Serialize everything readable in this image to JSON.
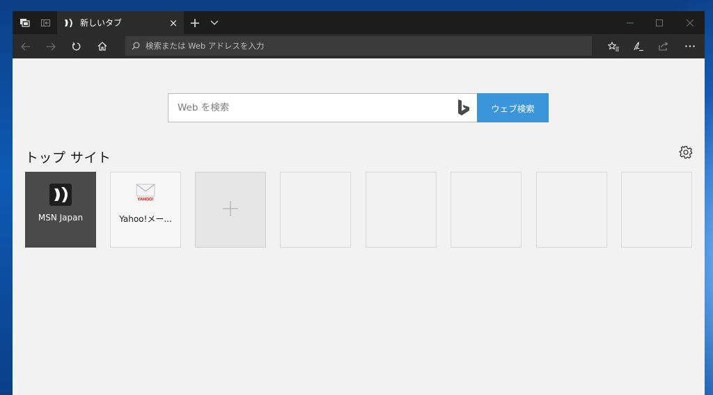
{
  "titlebar": {
    "tab": {
      "title": "新しいタブ"
    },
    "new_tab_glyph": "+",
    "close_glyph": "×"
  },
  "navbar": {
    "address_placeholder": "検索または Web アドレスを入力"
  },
  "newtab": {
    "search_placeholder": "Web を検索",
    "search_button": "ウェブ検索",
    "top_sites_title": "トップ サイト",
    "tiles": [
      {
        "label": "MSN Japan"
      },
      {
        "label": "Yahoo!メー...",
        "logo_text": "YAHOO!"
      }
    ]
  },
  "colors": {
    "titlebar_bg": "#1c1c1c",
    "navbar_bg": "#2b2b2b",
    "accent": "#3b95db",
    "content_bg": "#f2f2f2"
  },
  "icons": [
    "set-aside-tabs-icon",
    "tab-preview-icon",
    "msn-favicon-icon",
    "close-icon",
    "plus-icon",
    "chevron-down-icon",
    "minimize-icon",
    "maximize-icon",
    "back-icon",
    "forward-icon",
    "refresh-icon",
    "home-icon",
    "search-icon",
    "favorites-icon",
    "notes-icon",
    "share-icon",
    "more-icon",
    "bing-icon",
    "gear-icon",
    "mail-icon"
  ]
}
